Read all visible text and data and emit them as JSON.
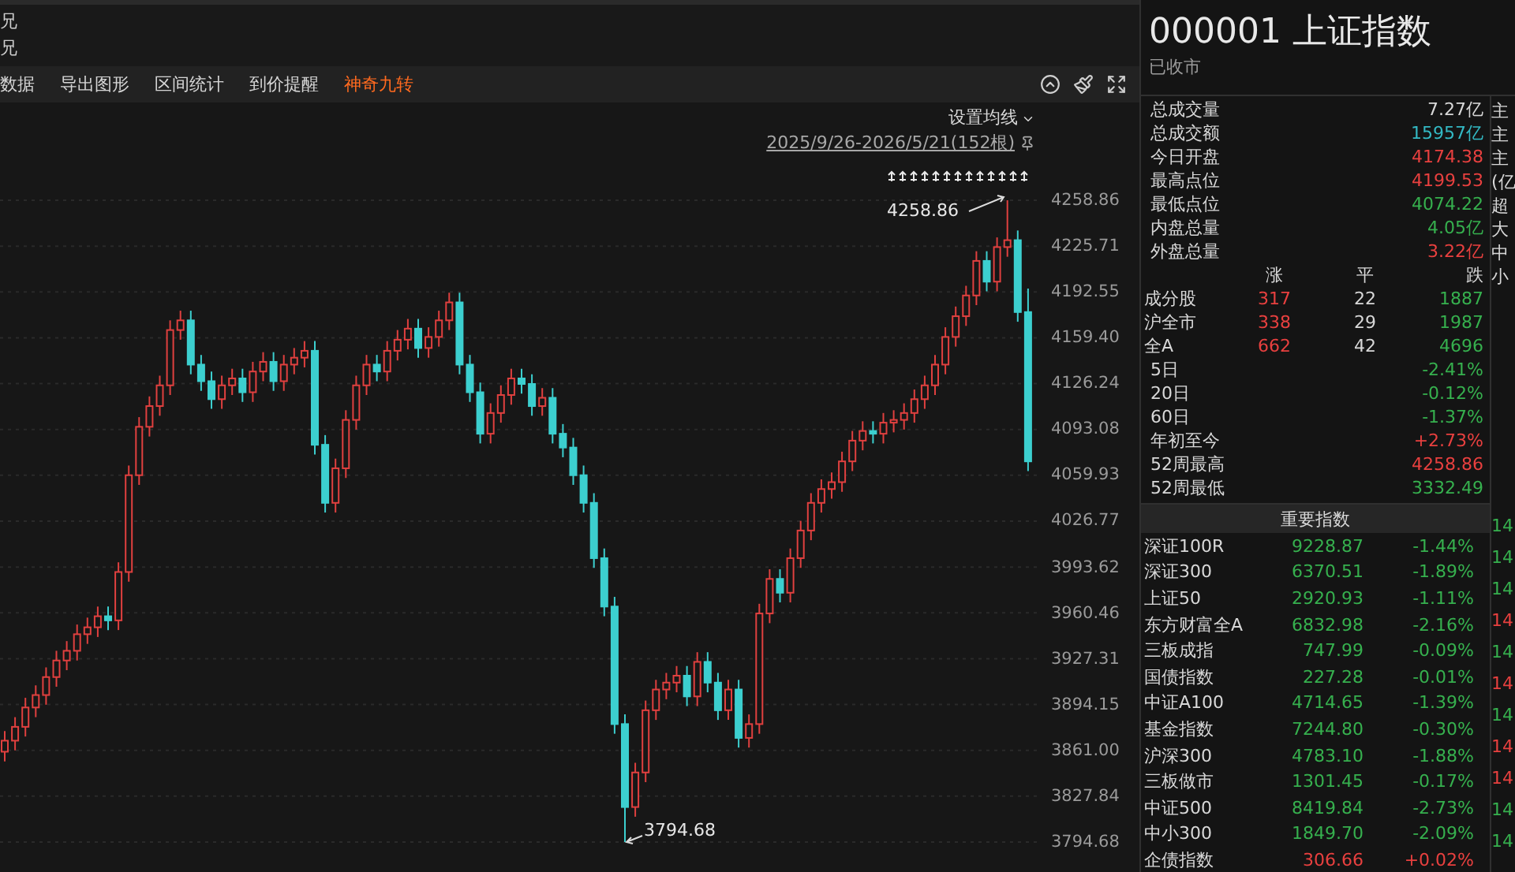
{
  "side_labels": [
    "兄",
    "兄"
  ],
  "toolbar": {
    "items": [
      {
        "label": "数据",
        "highlight": false
      },
      {
        "label": "导出图形",
        "highlight": false
      },
      {
        "label": "区间统计",
        "highlight": false
      },
      {
        "label": "到价提醒",
        "highlight": false
      },
      {
        "label": "神奇九转",
        "highlight": true
      }
    ]
  },
  "chart": {
    "ma_setting": "设置均线",
    "range": "2025/9/26-2026/5/21(152根)",
    "high_label": "4258.86",
    "low_label": "3794.68",
    "chart_data": {
      "type": "candlestick",
      "grid": true,
      "ylim": [
        3794.68,
        4258.86
      ],
      "yticks": [
        {
          "value": 4258.86,
          "label": "4258.86"
        },
        {
          "value": 4225.71,
          "label": "4225.71"
        },
        {
          "value": 4192.55,
          "label": "4192.55"
        },
        {
          "value": 4159.4,
          "label": "4159.40"
        },
        {
          "value": 4126.24,
          "label": "4126.24"
        },
        {
          "value": 4093.08,
          "label": "4093.08"
        },
        {
          "value": 4059.93,
          "label": "4059.93"
        },
        {
          "value": 4026.77,
          "label": "4026.77"
        },
        {
          "value": 3993.62,
          "label": "3993.62"
        },
        {
          "value": 3960.46,
          "label": "3960.46"
        },
        {
          "value": 3927.31,
          "label": "3927.31"
        },
        {
          "value": 3894.15,
          "label": "3894.15"
        },
        {
          "value": 3861,
          "label": "3861.00"
        },
        {
          "value": 3827.84,
          "label": "3827.84"
        },
        {
          "value": 3794.68,
          "label": "3794.68"
        }
      ],
      "ohlc": [
        [
          3860,
          3875,
          3853,
          3868
        ],
        [
          3868,
          3885,
          3861,
          3878
        ],
        [
          3878,
          3899,
          3871,
          3892
        ],
        [
          3892,
          3908,
          3885,
          3901
        ],
        [
          3901,
          3921,
          3894,
          3914
        ],
        [
          3914,
          3933,
          3907,
          3926
        ],
        [
          3926,
          3940,
          3919,
          3933
        ],
        [
          3933,
          3952,
          3926,
          3945
        ],
        [
          3945,
          3957,
          3938,
          3950
        ],
        [
          3950,
          3965,
          3943,
          3958
        ],
        [
          3958,
          3965,
          3948,
          3955
        ],
        [
          3955,
          3997,
          3948,
          3990
        ],
        [
          3990,
          4067,
          3983,
          4060
        ],
        [
          4060,
          4102,
          4053,
          4095
        ],
        [
          4095,
          4117,
          4088,
          4110
        ],
        [
          4110,
          4132,
          4103,
          4125
        ],
        [
          4125,
          4172,
          4118,
          4165
        ],
        [
          4165,
          4179,
          4158,
          4172
        ],
        [
          4172,
          4179,
          4133,
          4140
        ],
        [
          4140,
          4147,
          4121,
          4128
        ],
        [
          4128,
          4135,
          4108,
          4115
        ],
        [
          4115,
          4132,
          4108,
          4125
        ],
        [
          4125,
          4137,
          4118,
          4130
        ],
        [
          4130,
          4137,
          4113,
          4120
        ],
        [
          4120,
          4142,
          4113,
          4135
        ],
        [
          4135,
          4149,
          4128,
          4142
        ],
        [
          4142,
          4149,
          4121,
          4128
        ],
        [
          4128,
          4147,
          4121,
          4140
        ],
        [
          4140,
          4152,
          4133,
          4145
        ],
        [
          4145,
          4157,
          4138,
          4150
        ],
        [
          4150,
          4157,
          4075,
          4082
        ],
        [
          4082,
          4089,
          4033,
          4040
        ],
        [
          4040,
          4072,
          4033,
          4065
        ],
        [
          4065,
          4107,
          4058,
          4100
        ],
        [
          4100,
          4132,
          4093,
          4125
        ],
        [
          4125,
          4147,
          4118,
          4140
        ],
        [
          4140,
          4147,
          4128,
          4135
        ],
        [
          4135,
          4157,
          4128,
          4150
        ],
        [
          4150,
          4165,
          4143,
          4158
        ],
        [
          4158,
          4173,
          4151,
          4166
        ],
        [
          4166,
          4173,
          4145,
          4152
        ],
        [
          4152,
          4167,
          4145,
          4160
        ],
        [
          4160,
          4179,
          4153,
          4172
        ],
        [
          4172,
          4192,
          4165,
          4185
        ],
        [
          4185,
          4192,
          4133,
          4140
        ],
        [
          4140,
          4147,
          4113,
          4120
        ],
        [
          4120,
          4127,
          4083,
          4090
        ],
        [
          4090,
          4112,
          4083,
          4105
        ],
        [
          4105,
          4125,
          4098,
          4118
        ],
        [
          4118,
          4137,
          4111,
          4130
        ],
        [
          4130,
          4137,
          4119,
          4126
        ],
        [
          4126,
          4133,
          4103,
          4110
        ],
        [
          4110,
          4123,
          4103,
          4116
        ],
        [
          4116,
          4123,
          4083,
          4090
        ],
        [
          4090,
          4097,
          4073,
          4080
        ],
        [
          4080,
          4087,
          4053,
          4060
        ],
        [
          4060,
          4067,
          4033,
          4040
        ],
        [
          4040,
          4047,
          3993,
          4000
        ],
        [
          4000,
          4007,
          3958,
          3965
        ],
        [
          3965,
          3972,
          3873,
          3880
        ],
        [
          3880,
          3887,
          3794.68,
          3820
        ],
        [
          3820,
          3852,
          3813,
          3845
        ],
        [
          3845,
          3897,
          3838,
          3890
        ],
        [
          3890,
          3912,
          3883,
          3905
        ],
        [
          3905,
          3917,
          3898,
          3910
        ],
        [
          3910,
          3922,
          3903,
          3915
        ],
        [
          3915,
          3922,
          3893,
          3900
        ],
        [
          3900,
          3932,
          3893,
          3925
        ],
        [
          3925,
          3932,
          3903,
          3910
        ],
        [
          3910,
          3917,
          3883,
          3890
        ],
        [
          3890,
          3912,
          3883,
          3905
        ],
        [
          3905,
          3912,
          3863,
          3870
        ],
        [
          3870,
          3887,
          3863,
          3880
        ],
        [
          3880,
          3967,
          3873,
          3960
        ],
        [
          3960,
          3992,
          3953,
          3985
        ],
        [
          3985,
          3992,
          3968,
          3975
        ],
        [
          3975,
          4007,
          3968,
          4000
        ],
        [
          4000,
          4027,
          3993,
          4020
        ],
        [
          4020,
          4047,
          4013,
          4040
        ],
        [
          4040,
          4057,
          4033,
          4050
        ],
        [
          4050,
          4062,
          4043,
          4055
        ],
        [
          4055,
          4077,
          4048,
          4070
        ],
        [
          4070,
          4092,
          4063,
          4085
        ],
        [
          4085,
          4099,
          4078,
          4092
        ],
        [
          4092,
          4099,
          4083,
          4090
        ],
        [
          4090,
          4105,
          4083,
          4098
        ],
        [
          4098,
          4107,
          4091,
          4100
        ],
        [
          4100,
          4112,
          4093,
          4105
        ],
        [
          4105,
          4122,
          4098,
          4115
        ],
        [
          4115,
          4132,
          4108,
          4125
        ],
        [
          4125,
          4147,
          4118,
          4140
        ],
        [
          4140,
          4167,
          4133,
          4160
        ],
        [
          4160,
          4182,
          4153,
          4175
        ],
        [
          4175,
          4197,
          4168,
          4190
        ],
        [
          4190,
          4222,
          4183,
          4215
        ],
        [
          4215,
          4222,
          4193,
          4200
        ],
        [
          4200,
          4232,
          4193,
          4225
        ],
        [
          4225,
          4258.86,
          4218,
          4230
        ],
        [
          4230,
          4237,
          4171,
          4178
        ],
        [
          4178,
          4195,
          4063,
          4070
        ]
      ]
    }
  },
  "quote": {
    "code": "000001",
    "name": "上证指数",
    "status": "已收市",
    "stats": [
      {
        "label": "总成交量",
        "value": "7.27亿",
        "color": "#d8d8d8"
      },
      {
        "label": "总成交额",
        "value": "15957亿",
        "color": "#33b9c4"
      },
      {
        "label": "今日开盘",
        "value": "4174.38",
        "color": "#e8403f"
      },
      {
        "label": "最高点位",
        "value": "4199.53",
        "color": "#e8403f"
      },
      {
        "label": "最低点位",
        "value": "4074.22",
        "color": "#36b04e"
      },
      {
        "label": "内盘总量",
        "value": "4.05亿",
        "color": "#36b04e"
      },
      {
        "label": "外盘总量",
        "value": "3.22亿",
        "color": "#e8403f"
      }
    ],
    "breadth_header": [
      "涨",
      "平",
      "跌"
    ],
    "breadth": [
      {
        "label": "成分股",
        "up": "317",
        "flat": "22",
        "down": "1887"
      },
      {
        "label": "沪全市",
        "up": "338",
        "flat": "29",
        "down": "1987"
      },
      {
        "label": "全A",
        "up": "662",
        "flat": "42",
        "down": "4696"
      }
    ],
    "returns": [
      {
        "label": "5日",
        "value": "-2.41%",
        "color": "#36b04e"
      },
      {
        "label": "20日",
        "value": "-0.12%",
        "color": "#36b04e"
      },
      {
        "label": "60日",
        "value": "-1.37%",
        "color": "#36b04e"
      },
      {
        "label": "年初至今",
        "value": "+2.73%",
        "color": "#e8403f"
      },
      {
        "label": "52周最高",
        "value": "4258.86",
        "color": "#e8403f"
      },
      {
        "label": "52周最低",
        "value": "3332.49",
        "color": "#36b04e"
      }
    ]
  },
  "indices": {
    "title": "重要指数",
    "rows": [
      {
        "name": "深证100R",
        "value": "9228.87",
        "change": "-1.44%",
        "color": "#36b04e"
      },
      {
        "name": "深证300",
        "value": "6370.51",
        "change": "-1.89%",
        "color": "#36b04e"
      },
      {
        "name": "上证50",
        "value": "2920.93",
        "change": "-1.11%",
        "color": "#36b04e"
      },
      {
        "name": "东方财富全A",
        "value": "6832.98",
        "change": "-2.16%",
        "color": "#36b04e"
      },
      {
        "name": "三板成指",
        "value": "747.99",
        "change": "-0.09%",
        "color": "#36b04e"
      },
      {
        "name": "国债指数",
        "value": "227.28",
        "change": "-0.01%",
        "color": "#36b04e"
      },
      {
        "name": "中证A100",
        "value": "4714.65",
        "change": "-1.39%",
        "color": "#36b04e"
      },
      {
        "name": "基金指数",
        "value": "7244.80",
        "change": "-0.30%",
        "color": "#36b04e"
      },
      {
        "name": "沪深300",
        "value": "4783.10",
        "change": "-1.88%",
        "color": "#36b04e"
      },
      {
        "name": "三板做市",
        "value": "1301.45",
        "change": "-0.17%",
        "color": "#36b04e"
      },
      {
        "name": "中证500",
        "value": "8419.84",
        "change": "-2.73%",
        "color": "#36b04e"
      },
      {
        "name": "中小300",
        "value": "1849.70",
        "change": "-2.09%",
        "color": "#36b04e"
      },
      {
        "name": "企债指数",
        "value": "306.66",
        "change": "+0.02%",
        "color": "#e8403f"
      }
    ]
  },
  "edge_column": {
    "labels": [
      "主",
      "主",
      "主",
      "(亿",
      "超",
      "大",
      "中",
      "小"
    ],
    "values": [
      {
        "text": "14",
        "color": "#36b04e"
      },
      {
        "text": "14",
        "color": "#36b04e"
      },
      {
        "text": "14",
        "color": "#36b04e"
      },
      {
        "text": "14",
        "color": "#e8403f"
      },
      {
        "text": "14",
        "color": "#36b04e"
      },
      {
        "text": "14",
        "color": "#e8403f"
      },
      {
        "text": "14",
        "color": "#36b04e"
      },
      {
        "text": "14",
        "color": "#e8403f"
      },
      {
        "text": "14",
        "color": "#e8403f"
      },
      {
        "text": "14",
        "color": "#36b04e"
      },
      {
        "text": "14",
        "color": "#36b04e"
      }
    ]
  }
}
